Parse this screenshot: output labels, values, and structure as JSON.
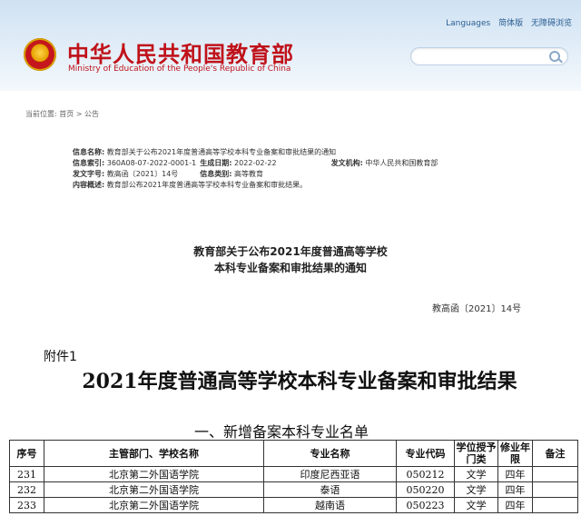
{
  "header": {
    "title": "中华人民共和国教育部",
    "subtitle": "Ministry of Education of the People's Republic of China",
    "links": [
      "Languages",
      "简体版",
      "无障碍浏览"
    ],
    "search_placeholder": ""
  },
  "breadcrumb": "当前位置: 首页 > 公告",
  "info": {
    "rows": [
      {
        "label": "信息名称:",
        "value": "教育部关于公布2021年度普通高等学校本科专业备案和审批结果的通知"
      },
      {
        "label": "信息索引:",
        "value": "360A08-07-2022-0001-1",
        "label2": "生成日期:",
        "value2": "2022-02-22",
        "label3": "发文机构:",
        "value3": "中华人民共和国教育部"
      },
      {
        "label": "发文字号:",
        "value": "教高函〔2021〕14号",
        "label2": "信息类别:",
        "value2": "高等教育"
      },
      {
        "label": "内容概述:",
        "value": "教育部公布2021年度普通高等学校本科专业备案和审批结果。"
      }
    ]
  },
  "notice": {
    "title_line1": "教育部关于公布2021年度普通高等学校",
    "title_line2": "本科专业备案和审批结果的通知",
    "doc_number": "教高函〔2021〕14号"
  },
  "attachment": {
    "label": "附件1",
    "title": "2021年度普通高等学校本科专业备案和审批结果",
    "section": "一、新增备案本科专业名单"
  },
  "table": {
    "headers": [
      "序号",
      "主管部门、学校名称",
      "专业名称",
      "专业代码",
      "学位授予门类",
      "修业年限",
      "备注"
    ],
    "rows": [
      [
        "231",
        "北京第二外国语学院",
        "印度尼西亚语",
        "050212",
        "文学",
        "四年",
        ""
      ],
      [
        "232",
        "北京第二外国语学院",
        "泰语",
        "050220",
        "文学",
        "四年",
        ""
      ],
      [
        "233",
        "北京第二外国语学院",
        "越南语",
        "050223",
        "文学",
        "四年",
        ""
      ]
    ]
  },
  "colors": {
    "brand": "#c0121a",
    "header_bg": "#dbe9f6"
  }
}
